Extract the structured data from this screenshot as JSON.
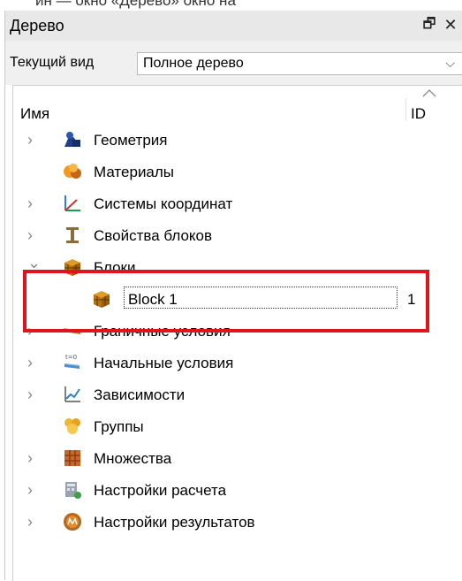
{
  "panel": {
    "title": "Дерево",
    "float_glyph": "🗗",
    "close_glyph": "✕"
  },
  "view": {
    "label": "Текущий вид",
    "selected": "Полное дерево",
    "chevron_glyph": "⌵"
  },
  "columns": {
    "name": "Имя",
    "id": "ID"
  },
  "tree": [
    {
      "label": "Геометрия",
      "icon": "geometry-icon",
      "expander": "›"
    },
    {
      "label": "Материалы",
      "icon": "materials-icon",
      "expander": ""
    },
    {
      "label": "Системы координат",
      "icon": "coordinate-systems-icon",
      "expander": "›"
    },
    {
      "label": "Свойства блоков",
      "icon": "block-properties-icon",
      "expander": "›"
    },
    {
      "label": "Блоки",
      "icon": "blocks-icon",
      "expander": "⌄",
      "children": [
        {
          "label": "Block 1",
          "id": "1",
          "icon": "block-icon"
        }
      ]
    },
    {
      "label": "Граничные условия",
      "icon": "boundary-conditions-icon",
      "expander": "›"
    },
    {
      "label": "Начальные условия",
      "icon": "initial-conditions-icon",
      "expander": "›"
    },
    {
      "label": "Зависимости",
      "icon": "dependencies-icon",
      "expander": "›"
    },
    {
      "label": "Группы",
      "icon": "groups-icon",
      "expander": ""
    },
    {
      "label": "Множества",
      "icon": "sets-icon",
      "expander": "›"
    },
    {
      "label": "Настройки расчета",
      "icon": "calculation-settings-icon",
      "expander": "›"
    },
    {
      "label": "Настройки результатов",
      "icon": "results-settings-icon",
      "expander": "›"
    }
  ],
  "highlight_color": "#e0141c"
}
